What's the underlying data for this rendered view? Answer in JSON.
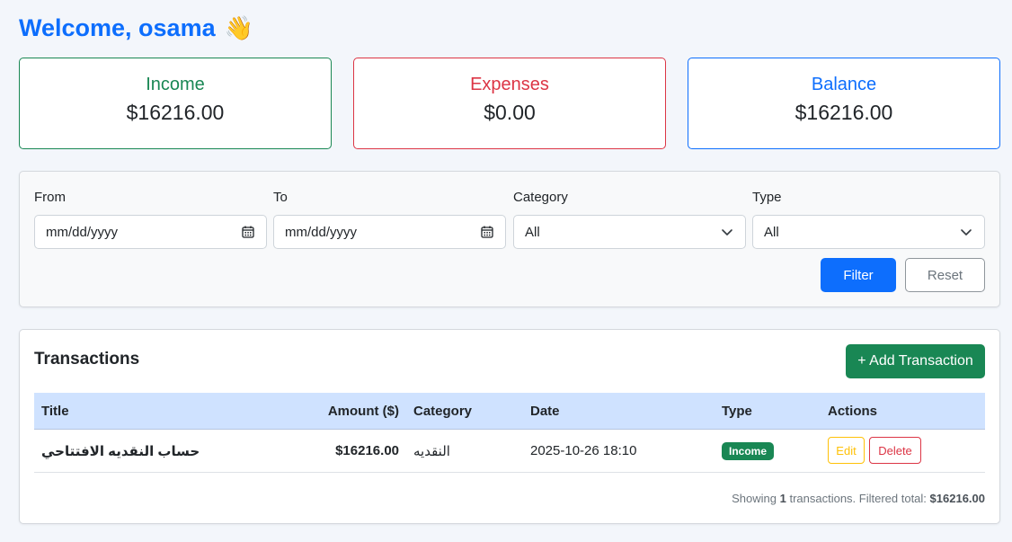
{
  "welcome": {
    "text": "Welcome, osama",
    "emoji": "👋"
  },
  "summary": {
    "income": {
      "label": "Income",
      "value": "$16216.00",
      "color": "#198754"
    },
    "expenses": {
      "label": "Expenses",
      "value": "$0.00",
      "color": "#dc3545"
    },
    "balance": {
      "label": "Balance",
      "value": "$16216.00",
      "color": "#0d6efd"
    }
  },
  "filters": {
    "from": {
      "label": "From",
      "placeholder": "mm/dd/yyyy"
    },
    "to": {
      "label": "To",
      "placeholder": "mm/dd/yyyy"
    },
    "category": {
      "label": "Category",
      "selected": "All"
    },
    "type": {
      "label": "Type",
      "selected": "All"
    },
    "filter_button": "Filter",
    "reset_button": "Reset"
  },
  "transactions": {
    "title": "Transactions",
    "add_button": "+ Add Transaction",
    "columns": [
      "Title",
      "Amount ($)",
      "Category",
      "Date",
      "Type",
      "Actions"
    ],
    "rows": [
      {
        "title": "حساب النقديه الافتتاحي",
        "amount": "$16216.00",
        "category": "النقديه",
        "date": "2025-10-26 18:10",
        "type": "Income",
        "edit": "Edit",
        "delete": "Delete"
      }
    ],
    "footer": {
      "prefix": "Showing",
      "count": "1",
      "middle": "transactions. Filtered total:",
      "total": "$16216.00"
    }
  }
}
